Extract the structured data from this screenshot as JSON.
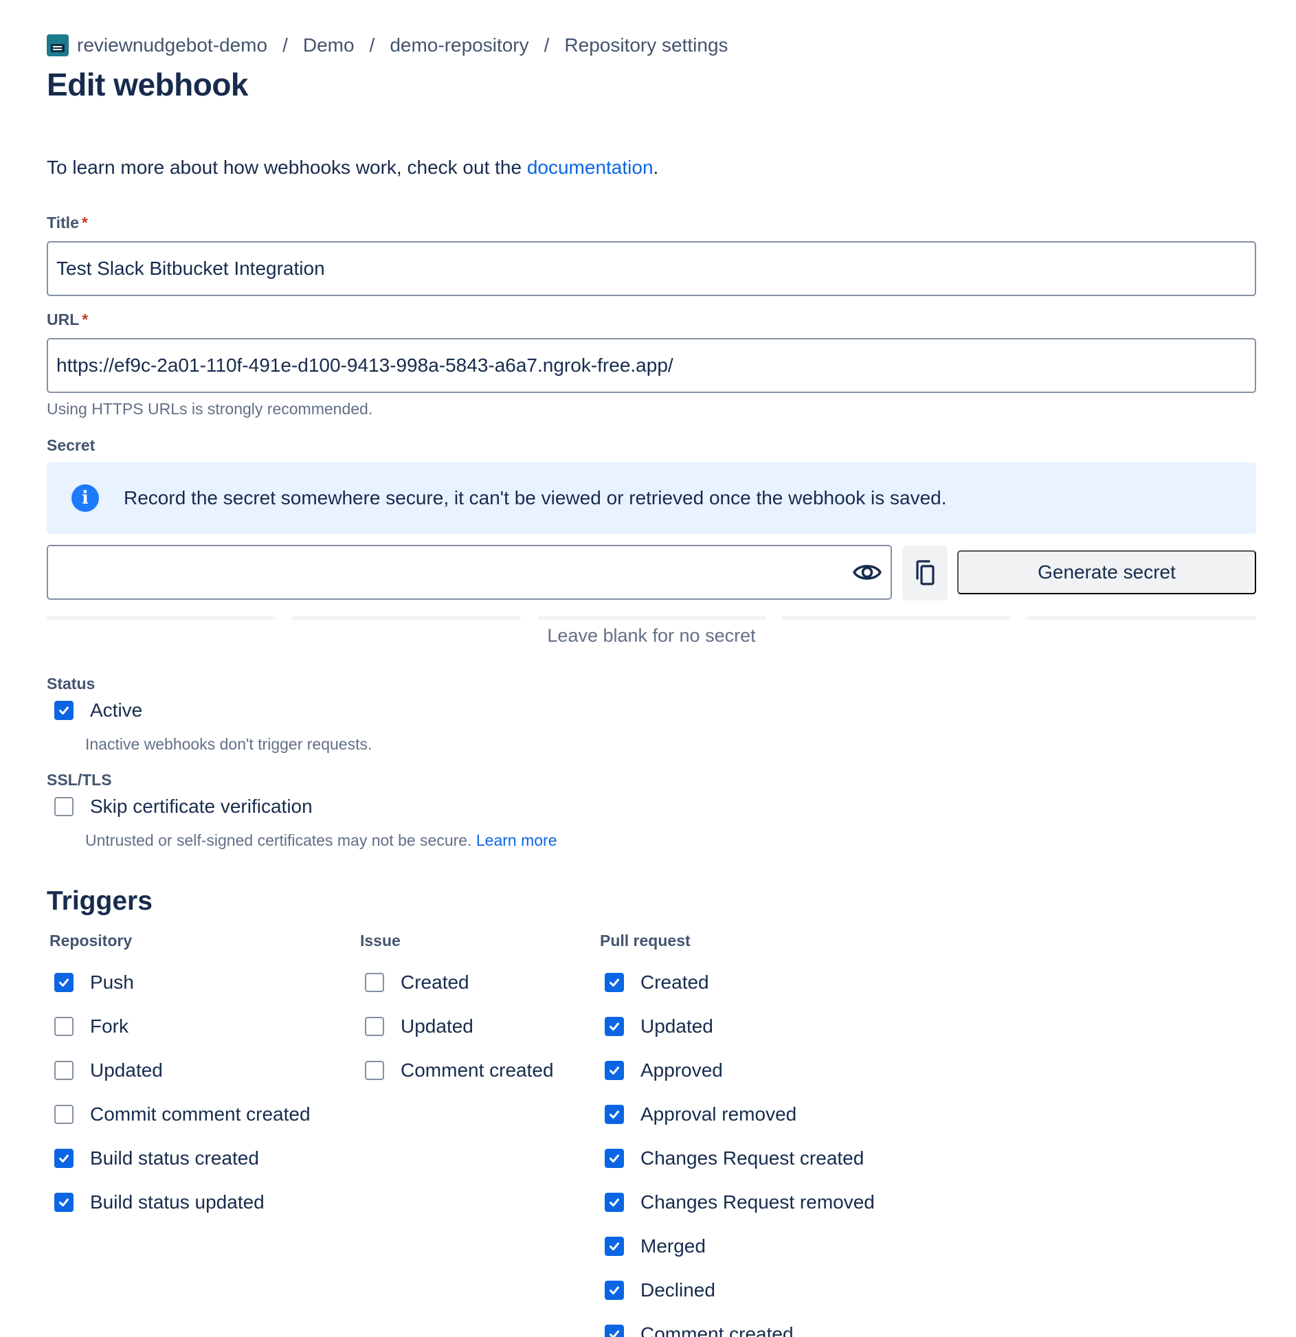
{
  "breadcrumb": {
    "workspace": "reviewnudgebot-demo",
    "project": "Demo",
    "repository": "demo-repository",
    "section": "Repository settings",
    "separator": "/"
  },
  "page_title": "Edit webhook",
  "intro": {
    "text": "To learn more about how webhooks work, check out the ",
    "link": "documentation",
    "suffix": "."
  },
  "title_field": {
    "label": "Title",
    "required_mark": "*",
    "value": "Test Slack Bitbucket Integration"
  },
  "url_field": {
    "label": "URL",
    "required_mark": "*",
    "value": "https://ef9c-2a01-110f-491e-d100-9413-998a-5843-a6a7.ngrok-free.app/",
    "helper": "Using HTTPS URLs is strongly recommended."
  },
  "secret": {
    "label": "Secret",
    "info_message": "Record the secret somewhere secure, it can't be viewed or retrieved once the webhook is saved.",
    "info_icon_glyph": "i",
    "value": "",
    "generate_label": "Generate secret",
    "strength_hint": "Leave blank for no secret"
  },
  "status": {
    "label": "Status",
    "active_label": "Active",
    "active_checked": true,
    "active_help": "Inactive webhooks don't trigger requests."
  },
  "ssl": {
    "label": "SSL/TLS",
    "skip_label": "Skip certificate verification",
    "skip_checked": false,
    "skip_help": "Untrusted or self-signed certificates may not be secure.",
    "learn_more": "Learn more"
  },
  "triggers": {
    "title": "Triggers",
    "repository": {
      "heading": "Repository",
      "items": [
        {
          "label": "Push",
          "checked": true
        },
        {
          "label": "Fork",
          "checked": false
        },
        {
          "label": "Updated",
          "checked": false
        },
        {
          "label": "Commit comment created",
          "checked": false
        },
        {
          "label": "Build status created",
          "checked": true
        },
        {
          "label": "Build status updated",
          "checked": true
        }
      ]
    },
    "issue": {
      "heading": "Issue",
      "items": [
        {
          "label": "Created",
          "checked": false
        },
        {
          "label": "Updated",
          "checked": false
        },
        {
          "label": "Comment created",
          "checked": false
        }
      ]
    },
    "pull_request": {
      "heading": "Pull request",
      "items": [
        {
          "label": "Created",
          "checked": true
        },
        {
          "label": "Updated",
          "checked": true
        },
        {
          "label": "Approved",
          "checked": true
        },
        {
          "label": "Approval removed",
          "checked": true
        },
        {
          "label": "Changes Request created",
          "checked": true
        },
        {
          "label": "Changes Request removed",
          "checked": true
        },
        {
          "label": "Merged",
          "checked": true
        },
        {
          "label": "Declined",
          "checked": true
        },
        {
          "label": "Comment created",
          "checked": true
        }
      ]
    }
  },
  "colors": {
    "accent": "#0c66e4",
    "text": "#172b4d",
    "subtle": "#44546f",
    "info_bg": "#e9f2ff",
    "required": "#c9372c"
  }
}
